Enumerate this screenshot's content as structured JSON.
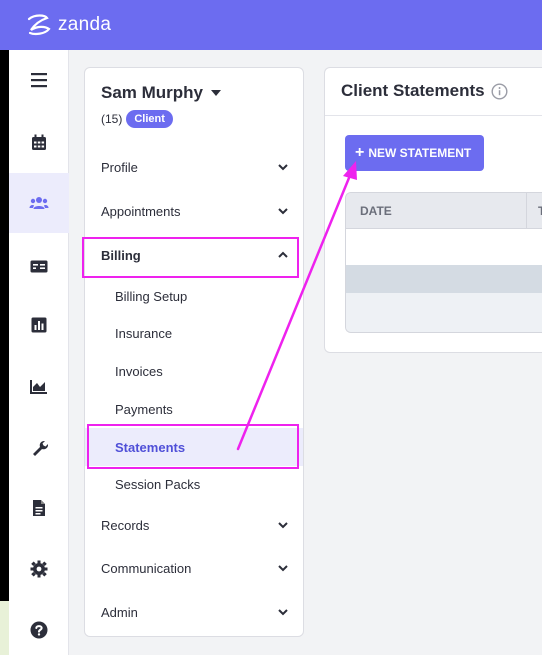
{
  "brand": {
    "name": "zanda"
  },
  "rail": {
    "items": [
      {
        "icon": "hamburger-icon"
      },
      {
        "icon": "calendar-icon"
      },
      {
        "icon": "users-icon",
        "active": true
      },
      {
        "icon": "id-card-icon"
      },
      {
        "icon": "bar-chart-icon"
      },
      {
        "icon": "area-chart-icon"
      },
      {
        "icon": "wrench-icon"
      },
      {
        "icon": "document-icon"
      },
      {
        "icon": "gear-icon"
      },
      {
        "icon": "help-icon"
      }
    ]
  },
  "client": {
    "name": "Sam Murphy",
    "count": "(15)",
    "badge": "Client"
  },
  "nav": {
    "profile": "Profile",
    "appointments": "Appointments",
    "billing": "Billing",
    "billing_sub": {
      "setup": "Billing Setup",
      "insurance": "Insurance",
      "invoices": "Invoices",
      "payments": "Payments",
      "statements": "Statements",
      "session_packs": "Session Packs"
    },
    "records": "Records",
    "communication": "Communication",
    "admin": "Admin"
  },
  "main": {
    "title": "Client Statements",
    "new_button": "NEW STATEMENT",
    "columns": [
      "DATE",
      "T"
    ]
  },
  "colors": {
    "brand": "#6c6cf0",
    "highlight": "#ee22ee",
    "active_bg": "#ececfc"
  }
}
